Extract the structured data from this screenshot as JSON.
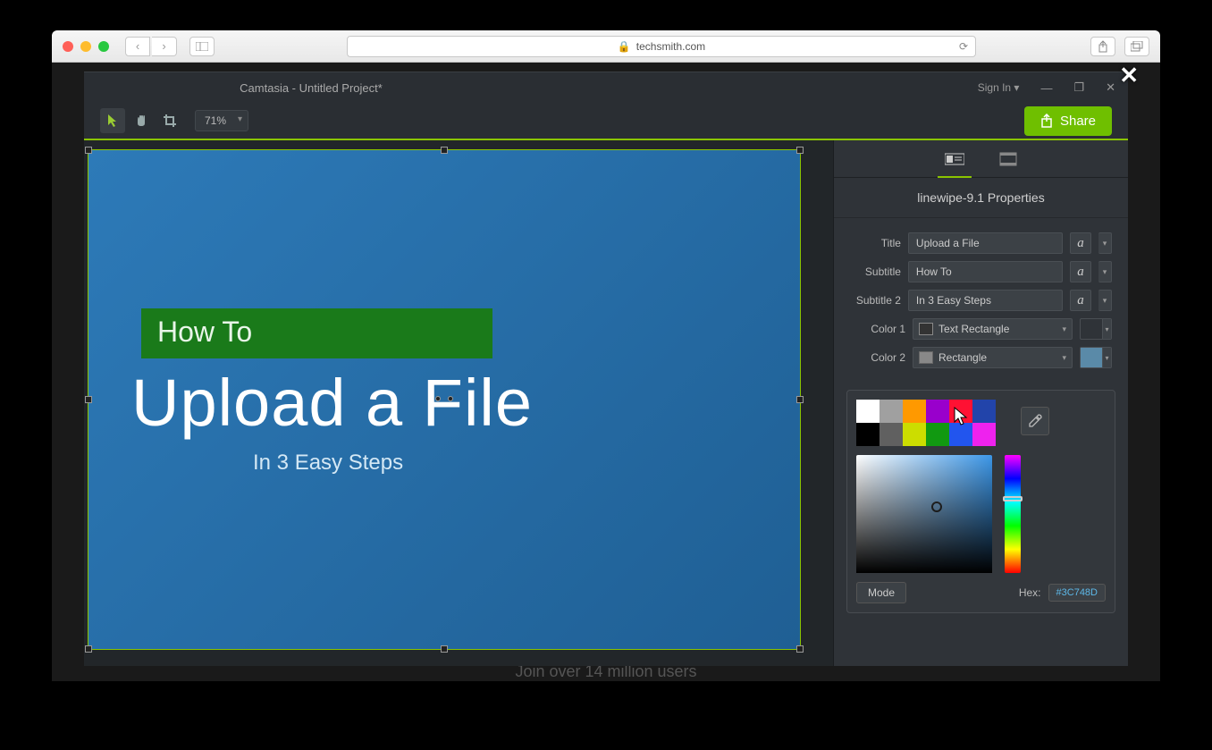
{
  "browser": {
    "url_host": "techsmith.com",
    "page_tagline": "Join over 14 million users"
  },
  "app": {
    "title": "Camtasia - Untitled Project*",
    "signin": "Sign In",
    "zoom": "71%",
    "share": "Share"
  },
  "canvas": {
    "subtitle": "How To",
    "title": "Upload a File",
    "subtitle2": "In 3 Easy Steps"
  },
  "properties": {
    "header": "linewipe-9.1 Properties",
    "rows": {
      "title": {
        "label": "Title",
        "value": "Upload a File"
      },
      "subtitle": {
        "label": "Subtitle",
        "value": "How To"
      },
      "subtitle2": {
        "label": "Subtitle 2",
        "value": "In 3 Easy Steps"
      },
      "color1": {
        "label": "Color 1",
        "target": "Text Rectangle",
        "color": "#1a9a1a"
      },
      "color2": {
        "label": "Color 2",
        "target": "Rectangle",
        "color": "#5a8aa8"
      }
    },
    "font_glyph": "a"
  },
  "colorpicker": {
    "swatches_row1": [
      "#ffffff",
      "#a0a0a0",
      "#ff9900",
      "#9900cc",
      "#ff1133",
      "#2244aa"
    ],
    "swatches_row2": [
      "#000000",
      "#606060",
      "#ccdd00",
      "#119911",
      "#2255ee",
      "#ee22ee"
    ],
    "mode_label": "Mode",
    "hex_label": "Hex:",
    "hex_value": "#3C748D"
  }
}
